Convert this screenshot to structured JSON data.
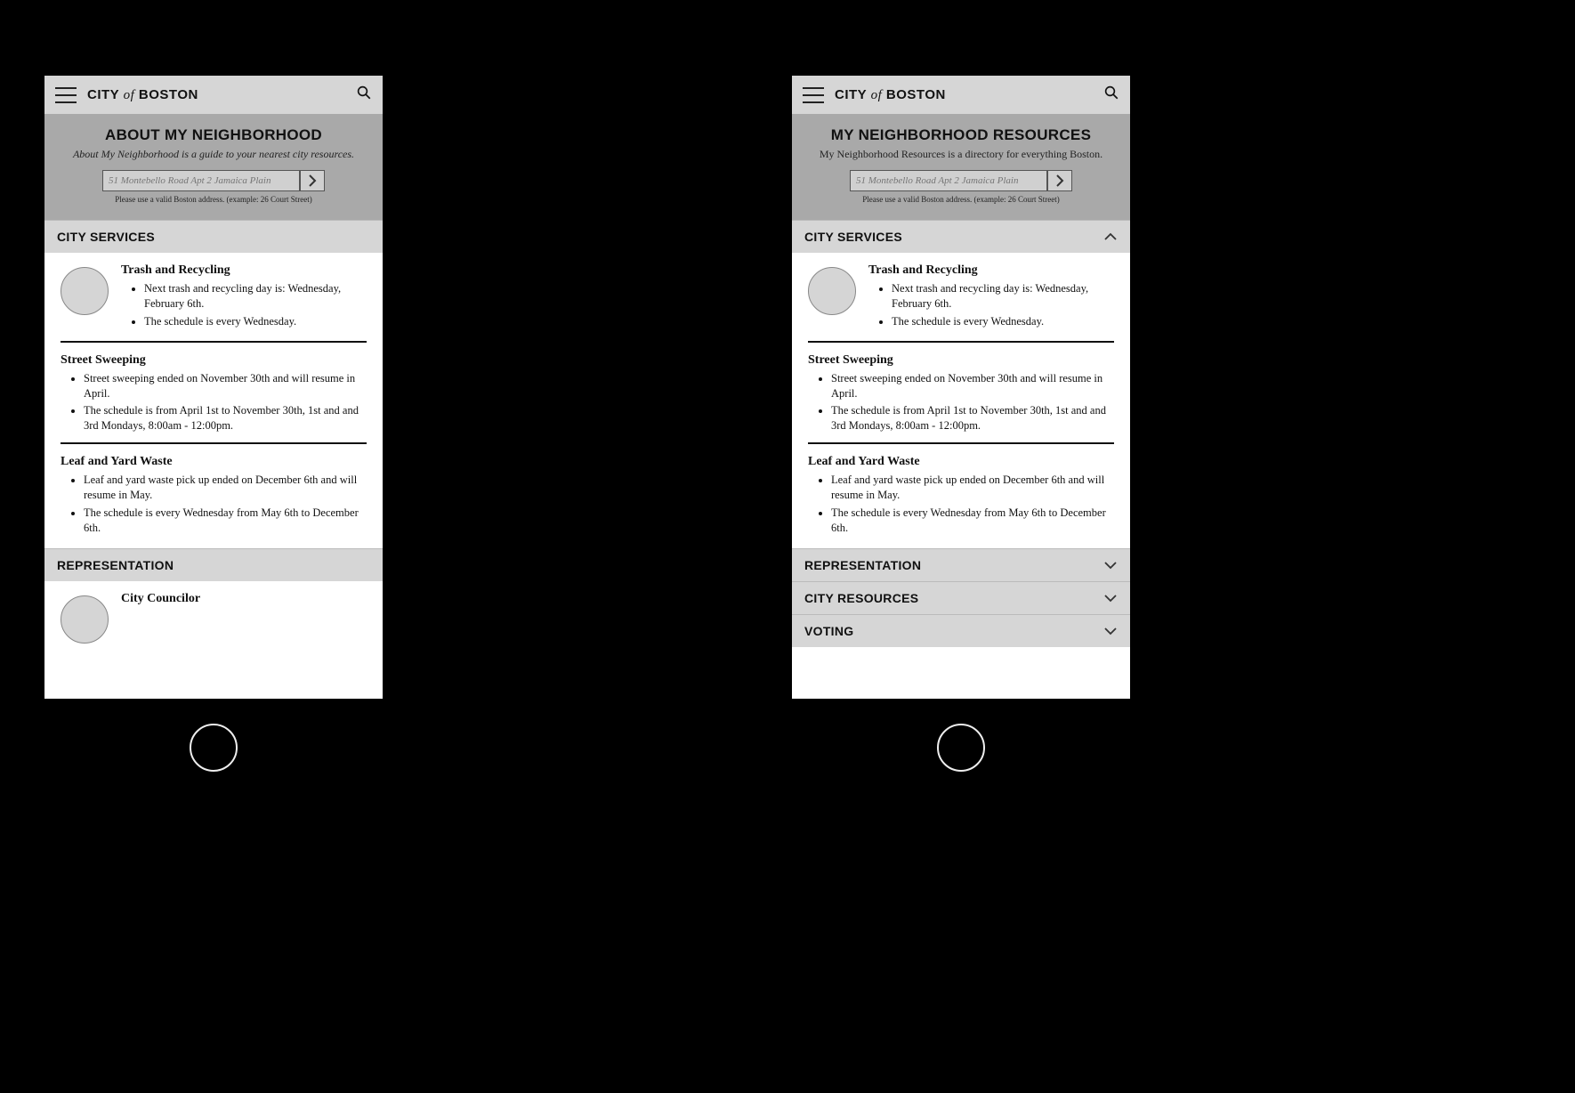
{
  "brand": {
    "city": "CITY",
    "of": "of",
    "boston": "BOSTON"
  },
  "left": {
    "hero": {
      "title": "ABOUT MY NEIGHBORHOOD",
      "subtitle": "About My Neighborhood is a guide to your nearest city resources.",
      "address_placeholder": "51 Montebello Road Apt 2 Jamaica Plain",
      "help": "Please use a valid Boston address. (example: 26 Court Street)"
    },
    "sections": {
      "city_services": {
        "label": "CITY SERVICES",
        "trash": {
          "title": "Trash and Recycling",
          "b1": "Next trash and recycling day is: Wednesday, February 6th.",
          "b2": "The schedule is every Wednesday."
        },
        "sweep": {
          "title": "Street Sweeping",
          "b1": "Street sweeping ended on November 30th and will resume in April.",
          "b2": "The schedule is from April 1st to November 30th, 1st and and 3rd Mondays, 8:00am - 12:00pm."
        },
        "leaf": {
          "title": "Leaf and Yard Waste",
          "b1": "Leaf and yard waste pick up ended on December 6th and will resume in May.",
          "b2": "The schedule is every Wednesday from May 6th to December 6th."
        }
      },
      "representation": {
        "label": "REPRESENTATION",
        "councilor": {
          "title": "City Councilor"
        }
      }
    }
  },
  "right": {
    "hero": {
      "title": "MY NEIGHBORHOOD RESOURCES",
      "subtitle": "My Neighborhood Resources is a directory for everything Boston.",
      "address_placeholder": "51 Montebello Road Apt 2 Jamaica Plain",
      "help": "Please use a valid Boston address. (example: 26 Court Street)"
    },
    "sections": {
      "city_services": {
        "label": "CITY SERVICES",
        "trash": {
          "title": "Trash and Recycling",
          "b1": "Next trash and recycling day is: Wednesday, February 6th.",
          "b2": "The schedule is every Wednesday."
        },
        "sweep": {
          "title": "Street Sweeping",
          "b1": "Street sweeping ended on November 30th and will resume in April.",
          "b2": "The schedule is from April 1st to November 30th, 1st and and 3rd Mondays, 8:00am - 12:00pm."
        },
        "leaf": {
          "title": "Leaf and Yard Waste",
          "b1": "Leaf and yard waste pick up ended on December 6th and will resume in May.",
          "b2": "The schedule is every Wednesday from May 6th to December 6th."
        }
      },
      "representation": {
        "label": "REPRESENTATION"
      },
      "city_resources": {
        "label": "CITY RESOURCES"
      },
      "voting": {
        "label": "VOTING"
      }
    }
  }
}
